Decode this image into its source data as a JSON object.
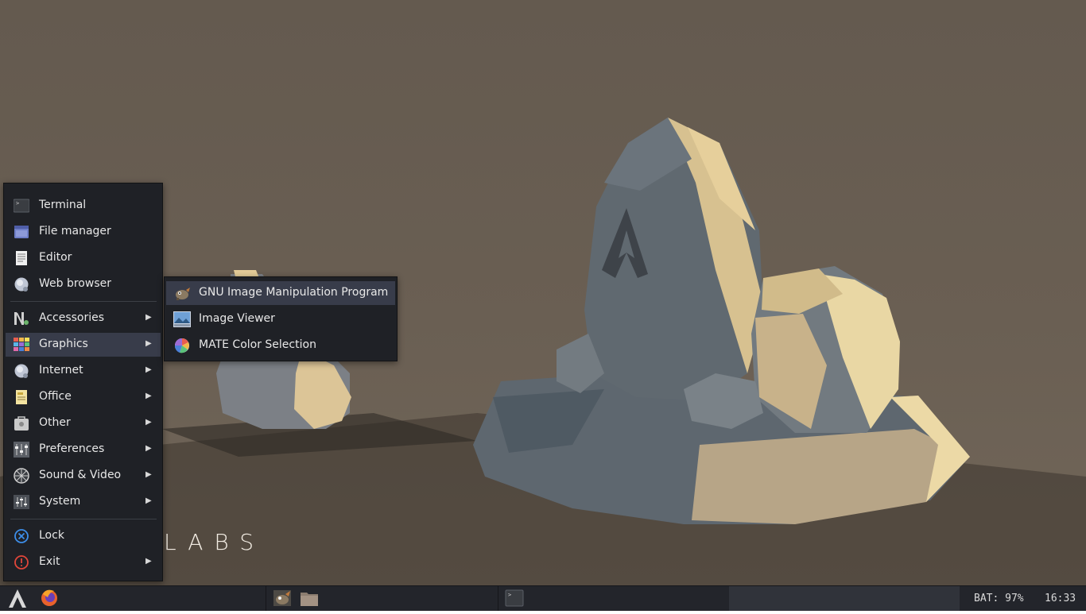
{
  "wallpaper": {
    "text": "LABS"
  },
  "main_menu": {
    "items": [
      {
        "label": "Terminal",
        "icon": "terminal-icon"
      },
      {
        "label": "File manager",
        "icon": "file-manager-icon"
      },
      {
        "label": "Editor",
        "icon": "editor-icon"
      },
      {
        "label": "Web browser",
        "icon": "web-browser-icon"
      }
    ],
    "categories": [
      {
        "label": "Accessories",
        "icon": "accessories-icon"
      },
      {
        "label": "Graphics",
        "icon": "graphics-icon"
      },
      {
        "label": "Internet",
        "icon": "internet-icon"
      },
      {
        "label": "Office",
        "icon": "office-icon"
      },
      {
        "label": "Other",
        "icon": "other-icon"
      },
      {
        "label": "Preferences",
        "icon": "preferences-icon"
      },
      {
        "label": "Sound & Video",
        "icon": "sound-video-icon"
      },
      {
        "label": "System",
        "icon": "system-icon"
      }
    ],
    "session": [
      {
        "label": "Lock",
        "icon": "lock-icon"
      },
      {
        "label": "Exit",
        "icon": "exit-icon"
      }
    ],
    "arrow": "▶"
  },
  "graphics_submenu": {
    "items": [
      {
        "label": "GNU Image Manipulation Program",
        "icon": "gimp-icon"
      },
      {
        "label": "Image Viewer",
        "icon": "image-viewer-icon"
      },
      {
        "label": "MATE Color Selection",
        "icon": "color-selection-icon"
      }
    ]
  },
  "panel": {
    "battery": "BAT: 97%",
    "clock": "16:33"
  },
  "colors": {
    "menu_bg": "#1f2126",
    "highlight": "#383c4a",
    "panel_bg": "#23252b"
  }
}
